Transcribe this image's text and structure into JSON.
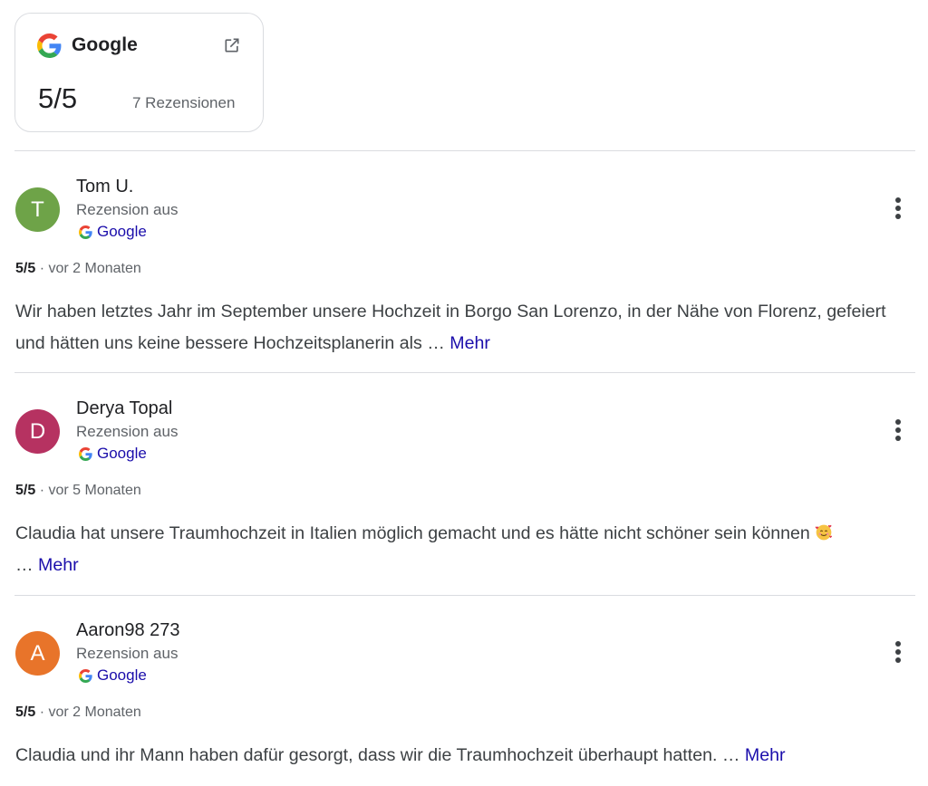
{
  "source": {
    "name": "Google",
    "rating": "5/5",
    "review_count": "7 Rezensionen"
  },
  "reviews": [
    {
      "initial": "T",
      "avatar_color": "#6ea348",
      "name": "Tom U.",
      "from_label": "Rezension aus",
      "source": "Google",
      "rating": "5/5",
      "time": "· vor 2 Monaten",
      "text": "Wir haben letztes Jahr im September unsere Hochzeit in Borgo San Lorenzo, in der Nähe von Florenz, gefeiert und hätten uns keine bessere Hochzeitsplanerin als …",
      "more": "Mehr"
    },
    {
      "initial": "D",
      "avatar_color": "#b63261",
      "name": "Derya Topal",
      "from_label": "Rezension aus",
      "source": "Google",
      "rating": "5/5",
      "time": "· vor 5 Monaten",
      "text": "Claudia hat unsere Traumhochzeit in Italien möglich gemacht und es hätte nicht schöner sein können",
      "emoji": "smiling-face-with-hearts",
      "text2": "…",
      "more": "Mehr"
    },
    {
      "initial": "A",
      "avatar_color": "#e8742a",
      "name": "Aaron98 273",
      "from_label": "Rezension aus",
      "source": "Google",
      "rating": "5/5",
      "time": "· vor 2 Monaten",
      "text": "Claudia und ihr Mann haben dafür gesorgt, dass wir die Traumhochzeit überhaupt hatten. …",
      "more": "Mehr"
    }
  ],
  "colors": {
    "link": "#1a0dab",
    "secondary_text": "#5f6368",
    "divider": "#dadce0"
  }
}
